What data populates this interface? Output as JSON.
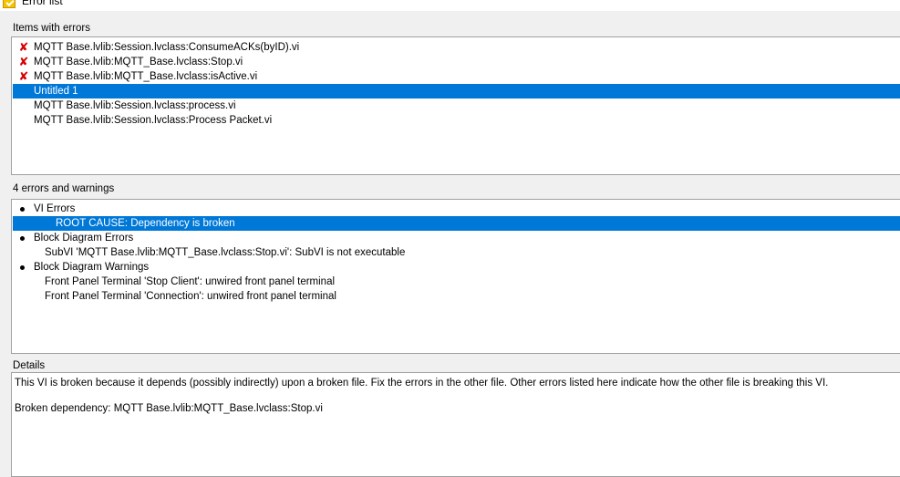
{
  "window": {
    "title": "Error list"
  },
  "items_section": {
    "label": "Items with errors",
    "items": [
      {
        "label": "MQTT Base.lvlib:Session.lvclass:ConsumeACKs(byID).vi",
        "error": true,
        "selected": false
      },
      {
        "label": "MQTT Base.lvlib:MQTT_Base.lvclass:Stop.vi",
        "error": true,
        "selected": false
      },
      {
        "label": "MQTT Base.lvlib:MQTT_Base.lvclass:isActive.vi",
        "error": true,
        "selected": false
      },
      {
        "label": "Untitled 1",
        "error": false,
        "selected": true
      },
      {
        "label": "MQTT Base.lvlib:Session.lvclass:process.vi",
        "error": false,
        "selected": false
      },
      {
        "label": "MQTT Base.lvlib:Session.lvclass:Process Packet.vi",
        "error": false,
        "selected": false
      }
    ]
  },
  "errors_section": {
    "label": "4 errors and warnings",
    "items": [
      {
        "label": "VI Errors",
        "level": 0,
        "bullet": true,
        "selected": false
      },
      {
        "label": "ROOT CAUSE: Dependency is broken",
        "level": 2,
        "bullet": false,
        "selected": true
      },
      {
        "label": "Block Diagram Errors",
        "level": 0,
        "bullet": true,
        "selected": false
      },
      {
        "label": "SubVI 'MQTT Base.lvlib:MQTT_Base.lvclass:Stop.vi': SubVI is not executable",
        "level": 1,
        "bullet": false,
        "selected": false
      },
      {
        "label": "Block Diagram Warnings",
        "level": 0,
        "bullet": true,
        "selected": false
      },
      {
        "label": "Front Panel Terminal 'Stop Client': unwired front panel terminal",
        "level": 1,
        "bullet": false,
        "selected": false
      },
      {
        "label": "Front Panel Terminal 'Connection': unwired front panel terminal",
        "level": 1,
        "bullet": false,
        "selected": false
      }
    ]
  },
  "details_section": {
    "label": "Details",
    "text": "This VI is broken because it depends (possibly indirectly) upon a broken file. Fix the errors in the other file. Other errors listed here indicate how the other file is breaking this VI.\n\nBroken dependency: MQTT Base.lvlib:MQTT_Base.lvclass:Stop.vi"
  },
  "colors": {
    "selection": "#0078d7",
    "error_icon": "#d80000",
    "panel_border": "#a0a0a0"
  },
  "icons": {
    "error": "x-mark-icon",
    "bullet": "bullet-icon",
    "window": "warning-icon"
  }
}
